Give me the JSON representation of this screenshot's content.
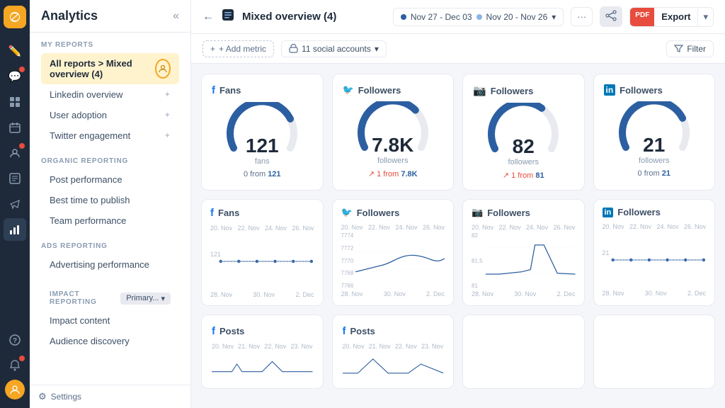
{
  "app": {
    "title": "Analytics"
  },
  "iconbar": {
    "items": [
      {
        "name": "brand",
        "icon": "🦋",
        "active": false,
        "brand": true
      },
      {
        "name": "compose",
        "icon": "✏️",
        "active": false
      },
      {
        "name": "inbox",
        "icon": "💬",
        "active": false
      },
      {
        "name": "publishing",
        "icon": "⊞",
        "active": false
      },
      {
        "name": "calendar",
        "icon": "📅",
        "active": false
      },
      {
        "name": "listening",
        "icon": "👤",
        "active": false,
        "badge": true
      },
      {
        "name": "reports",
        "icon": "📋",
        "active": false
      },
      {
        "name": "campaigns",
        "icon": "📢",
        "active": false
      },
      {
        "name": "analytics",
        "icon": "📊",
        "active": true
      },
      {
        "name": "help",
        "icon": "❓",
        "active": false
      },
      {
        "name": "settings",
        "icon": "⚙️",
        "active": false
      },
      {
        "name": "alerts",
        "icon": "🔔",
        "active": false,
        "badge": true
      }
    ]
  },
  "sidebar": {
    "title": "Analytics",
    "my_reports_label": "MY REPORTS",
    "active_item": "All reports > Mixed overview (4)",
    "reports": [
      {
        "label": "Linkedin overview",
        "pin": true
      },
      {
        "label": "User adoption",
        "pin": true
      },
      {
        "label": "Twitter engagement",
        "pin": true
      }
    ],
    "organic_label": "ORGANIC REPORTING",
    "organic_items": [
      {
        "label": "Post performance"
      },
      {
        "label": "Best time to publish"
      },
      {
        "label": "Team performance"
      }
    ],
    "ads_label": "ADS REPORTING",
    "ads_items": [
      {
        "label": "Advertising performance"
      }
    ],
    "impact_label": "IMPACT REPORTING",
    "impact_badge": "Primary...",
    "impact_items": [
      {
        "label": "Impact content"
      },
      {
        "label": "Audience discovery"
      }
    ],
    "settings_label": "Settings"
  },
  "topbar": {
    "title": "Mixed overview (4)",
    "date_range_1": "Nov 27 - Dec 03",
    "date_range_2": "Nov 20 - Nov 26",
    "export_pdf": "PDF",
    "export_label": "Export"
  },
  "toolbar": {
    "add_metric": "+ Add metric",
    "accounts": "11 social accounts",
    "filter": "Filter"
  },
  "metrics": [
    {
      "platform": "facebook",
      "platform_icon": "f",
      "platform_color": "#1877f2",
      "title": "Fans",
      "value": "121",
      "unit": "fans",
      "change": "0 from 121",
      "change_type": "neutral",
      "prev_value": "121"
    },
    {
      "platform": "twitter",
      "platform_icon": "t",
      "platform_color": "#1da1f2",
      "title": "Followers",
      "value": "7.8K",
      "unit": "followers",
      "change": "1 from 7.8K",
      "change_type": "up",
      "prev_value": "7.8K"
    },
    {
      "platform": "instagram",
      "platform_icon": "i",
      "platform_color": "#e1306c",
      "title": "Followers",
      "value": "82",
      "unit": "followers",
      "change": "1 from 81",
      "change_type": "up",
      "prev_value": "81"
    },
    {
      "platform": "linkedin",
      "platform_icon": "in",
      "platform_color": "#0077b5",
      "title": "Followers",
      "value": "21",
      "unit": "followers",
      "change": "0 from 21",
      "change_type": "neutral",
      "prev_value": "21"
    }
  ],
  "charts": [
    {
      "platform": "facebook",
      "platform_color": "#1877f2",
      "title": "Fans",
      "x_labels": [
        "20. Nov",
        "22. Nov",
        "24. Nov",
        "26. Nov"
      ],
      "y_labels": [
        "121",
        ""
      ],
      "x_labels_bottom": [
        "28. Nov",
        "30. Nov",
        "2. Dec"
      ],
      "flat": true,
      "flat_value": "121"
    },
    {
      "platform": "twitter",
      "platform_color": "#1da1f2",
      "title": "Followers",
      "x_labels": [
        "20. Nov",
        "22. Nov",
        "24. Nov",
        "26. Nov"
      ],
      "y_labels": [
        "7774",
        "7772",
        "7770",
        "7768",
        "7766"
      ],
      "x_labels_bottom": [
        "28. Nov",
        "30. Nov",
        "2. Dec"
      ],
      "flat": false
    },
    {
      "platform": "instagram",
      "platform_color": "#e1306c",
      "title": "Followers",
      "x_labels": [
        "20. Nov",
        "22. Nov",
        "24. Nov",
        "26. Nov"
      ],
      "y_labels": [
        "82",
        "81.5",
        "81"
      ],
      "x_labels_bottom": [
        "28. Nov",
        "30. Nov",
        "2. Dec"
      ],
      "flat": false
    },
    {
      "platform": "linkedin",
      "platform_color": "#0077b5",
      "title": "Followers",
      "x_labels": [
        "20. Nov",
        "22. Nov",
        "24. Nov",
        "26. Nov"
      ],
      "y_labels": [
        "21",
        ""
      ],
      "x_labels_bottom": [
        "28. Nov",
        "30. Nov",
        "2. Dec"
      ],
      "flat": true,
      "flat_value": "21"
    }
  ],
  "posts_row": [
    {
      "platform": "facebook",
      "platform_color": "#1877f2",
      "title": "Posts",
      "has_chart": true
    },
    {
      "platform": "facebook",
      "platform_color": "#1877f2",
      "title": "Posts",
      "has_chart": true
    },
    {
      "platform": "",
      "platform_color": "",
      "title": "",
      "has_chart": false
    },
    {
      "platform": "",
      "platform_color": "",
      "title": "",
      "has_chart": false
    }
  ]
}
